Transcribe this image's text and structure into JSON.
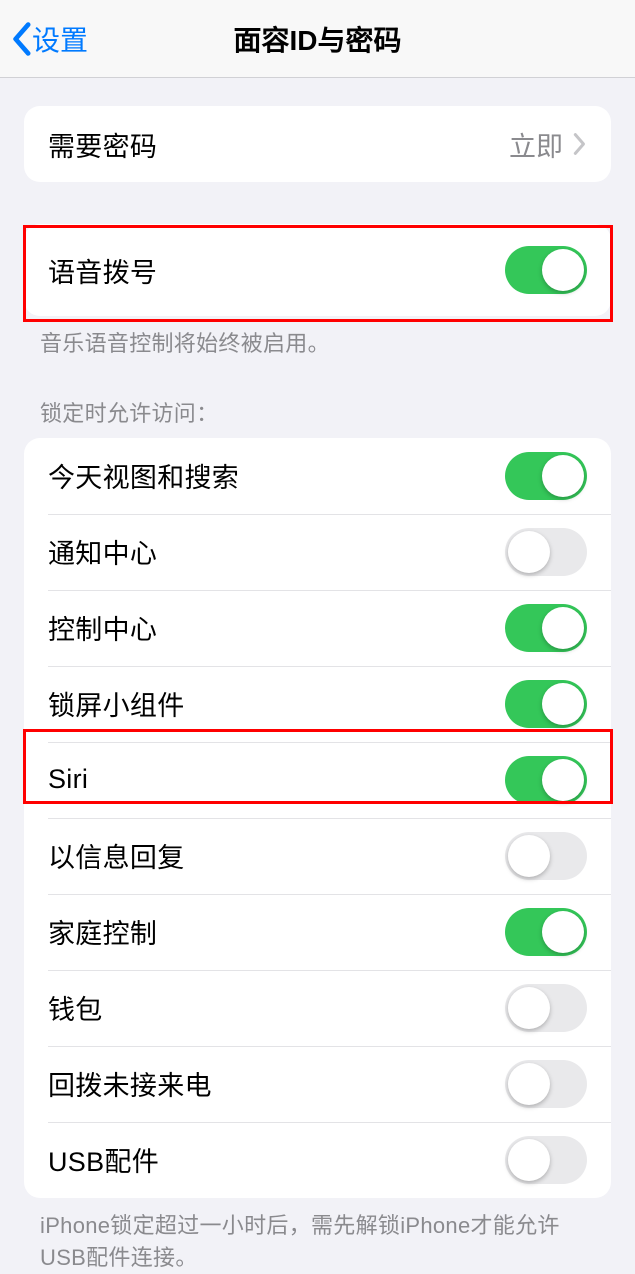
{
  "nav": {
    "back": "设置",
    "title": "面容ID与密码"
  },
  "passcode": {
    "label": "需要密码",
    "value": "立即"
  },
  "voice_dial": {
    "label": "语音拨号",
    "footer": "音乐语音控制将始终被启用。"
  },
  "locked_header": "锁定时允许访问：",
  "locked": [
    {
      "label": "今天视图和搜索",
      "on": true
    },
    {
      "label": "通知中心",
      "on": false
    },
    {
      "label": "控制中心",
      "on": true
    },
    {
      "label": "锁屏小组件",
      "on": true
    },
    {
      "label": "Siri",
      "on": true
    },
    {
      "label": "以信息回复",
      "on": false
    },
    {
      "label": "家庭控制",
      "on": true
    },
    {
      "label": "钱包",
      "on": false
    },
    {
      "label": "回拨未接来电",
      "on": false
    },
    {
      "label": "USB配件",
      "on": false
    }
  ],
  "usb_footer": "iPhone锁定超过一小时后，需先解锁iPhone才能允许USB配件连接。"
}
